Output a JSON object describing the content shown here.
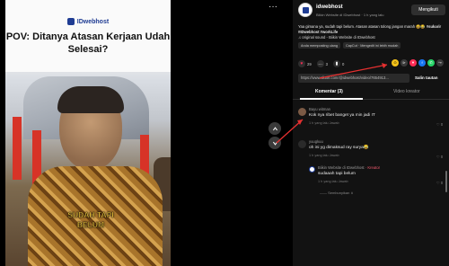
{
  "video": {
    "brand": "IDwebhost",
    "title": "POV: Ditanya Atasan Kerjaan Udah Selesai?",
    "subtitle": "SUDAH TAPI BELUM"
  },
  "controls": {
    "more": "···"
  },
  "author": {
    "name": "idwebhost",
    "sub": "Biikin Website di IDwebhost · 1 h yang lalu",
    "follow_label": "Mengikuti"
  },
  "description": {
    "text": "Yaa gimana ya, sudah tapi belum. Atasan atasan tolong jangan marah 😆😂",
    "tags": "#sukarir #IDwebhost #workLife",
    "sound": "♫ original sound - Biikin Website di IDwebhost",
    "chip_1": "Anda memposting ulang",
    "chip_2": "CapCut · Mengedit ini lebih mudah"
  },
  "stats": {
    "likes": "29",
    "comments": "3",
    "saves": "0"
  },
  "link": {
    "url": "https://www.tiktok.com/@idwebhost/video/7654913...",
    "copy_label": "Salin tautan"
  },
  "tabs": {
    "comments": "Komentar (3)",
    "creator": "Video kreator"
  },
  "comments": [
    {
      "name": "Bayu witman",
      "text": "Kok nya ribet banget ya min jadi IT",
      "meta": "1 h yang lalu   Jawab",
      "likes": "0"
    },
    {
      "name": "yuugkuu",
      "text": "oh ini yg dimaksud ray surya😂",
      "meta": "1 h yang lalu   Jawab",
      "likes": "0"
    },
    {
      "name": "Biikin Website di IDwebhost",
      "creator": "· Kreator",
      "text": "sudaaah tapi belum",
      "meta": "1 h yang lalu   Jawab",
      "likes": "0"
    }
  ],
  "collapse": "—— Sembunyikan ∧",
  "colors": {
    "accent": "#fe2c55",
    "background": "#121212",
    "annotation": "#e53030"
  },
  "share_icons": [
    "embed-icon",
    "send-icon",
    "whatsapp-icon",
    "facebook-icon",
    "x-icon",
    "share-icon"
  ]
}
